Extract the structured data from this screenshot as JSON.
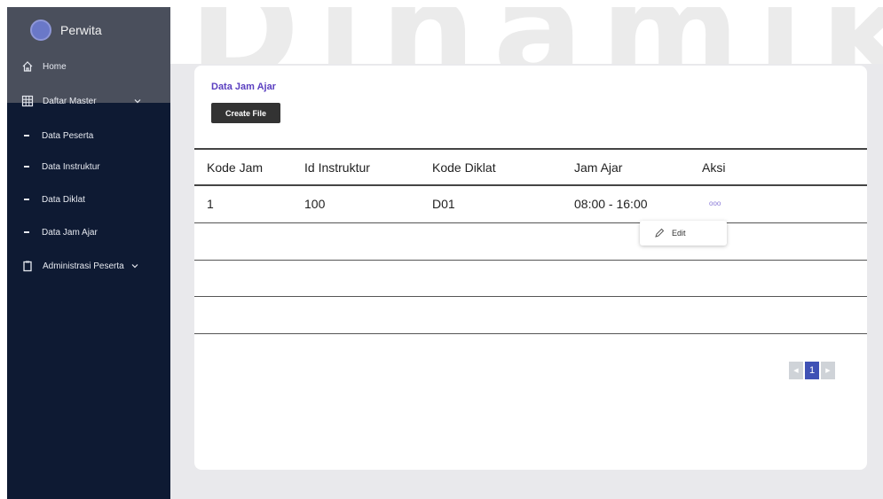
{
  "watermark": {
    "text": "Dinamik"
  },
  "sidebar": {
    "brand": "Perwita",
    "items": [
      {
        "label": "Home",
        "icon": "home-icon"
      },
      {
        "label": "Daftar Master",
        "icon": "grid-icon",
        "expandable": true
      },
      {
        "label": "Data Peserta",
        "icon": "dash-icon"
      },
      {
        "label": "Data Instruktur",
        "icon": "dash-icon"
      },
      {
        "label": "Data Diklat",
        "icon": "dash-icon"
      },
      {
        "label": "Data Jam Ajar",
        "icon": "dash-icon"
      },
      {
        "label": "Administrasi Peserta",
        "icon": "clipboard-icon",
        "expandable": true
      }
    ]
  },
  "main": {
    "title": "Data Jam Ajar",
    "create_button": "Create File",
    "table": {
      "headers": [
        "Kode Jam",
        "Id Instruktur",
        "Kode Diklat",
        "Jam Ajar",
        "Aksi"
      ],
      "rows": [
        {
          "kode_jam": "1",
          "id_instruktur": "100",
          "kode_diklat": "D01",
          "jam_ajar": "08:00 - 16:00",
          "aksi": "ooo"
        }
      ]
    },
    "action_menu": {
      "edit_label": "Edit"
    },
    "pagination": {
      "prev": "◀",
      "current": "1",
      "next": "▶"
    }
  },
  "colors": {
    "sidebar": "#0e1a33",
    "accent": "#5a3fc0",
    "page_active": "#3f51b5"
  }
}
